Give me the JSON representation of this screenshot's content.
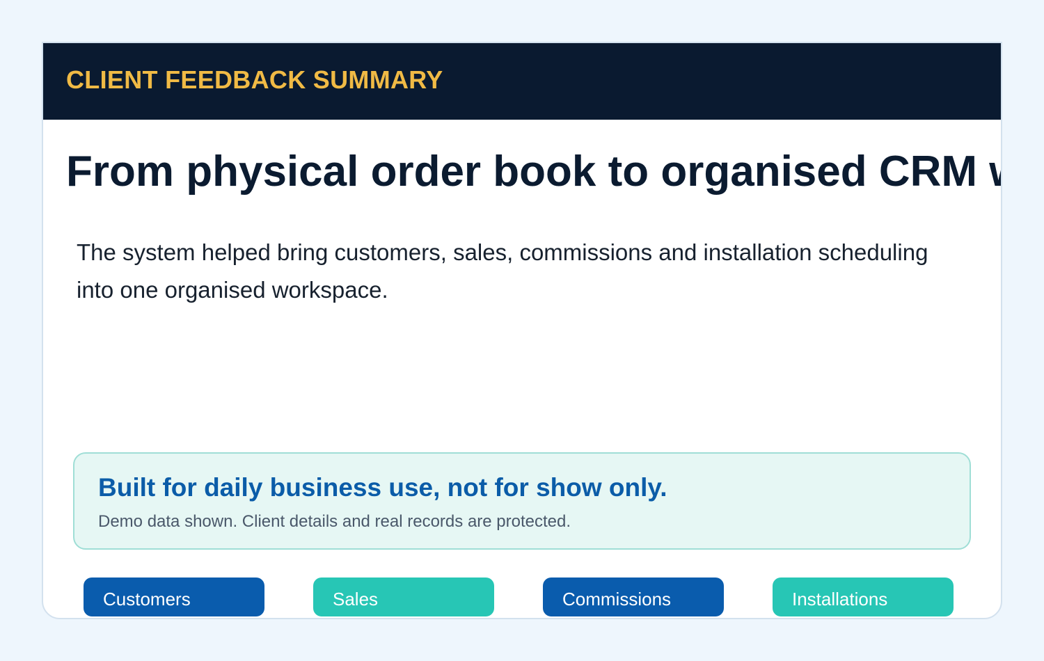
{
  "header": {
    "title": "CLIENT FEEDBACK SUMMARY"
  },
  "main": {
    "headline": "From physical order book to organised CRM workflow",
    "description": "The system helped bring customers, sales, commissions and installation scheduling into one organised workspace."
  },
  "highlight": {
    "title": "Built for daily business use, not for show only.",
    "note": "Demo data shown. Client details and real records are protected."
  },
  "modules": [
    {
      "label": "Customers",
      "color": "#0a5cad"
    },
    {
      "label": "Sales",
      "color": "#27c6b5"
    },
    {
      "label": "Commissions",
      "color": "#0a5cad"
    },
    {
      "label": "Installations",
      "color": "#27c6b5"
    }
  ],
  "colors": {
    "background": "#eef6fd",
    "header": "#0a1a30",
    "accent": "#f0ba45",
    "primary_blue": "#0a5cad",
    "teal": "#27c6b5"
  }
}
